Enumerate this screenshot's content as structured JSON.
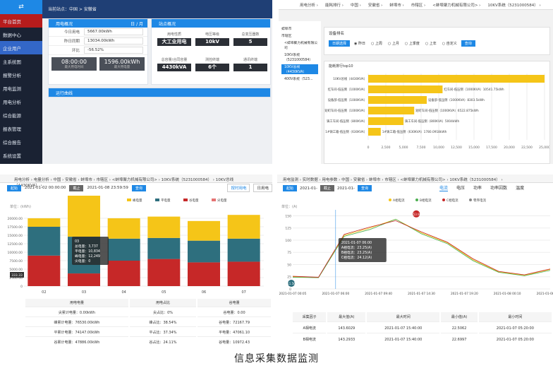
{
  "p1": {
    "top_icon": "⇄",
    "sidebar": [
      "平台首页",
      "数据中心",
      "企业用户",
      "主系统图",
      "报警分析",
      "用电监测",
      "用电分析",
      "综合能源",
      "报表管理",
      "综合报告",
      "系统设置"
    ],
    "breadcrumb": "当前站点：中国 > 安徽省",
    "elec_title": "用电概况",
    "period": "日 / 月",
    "rows": [
      {
        "k": "今日用电",
        "v": "5667.00kWh"
      },
      {
        "k": "昨日同期",
        "v": "13034.00kWh"
      },
      {
        "k": "环比",
        "v": "-56.52%"
      }
    ],
    "max_time": "08:00:00",
    "max_val": "1596.00kWh",
    "max_time_label": "最大用电时间",
    "max_val_label": "最大用电量",
    "site_title": "站点概况",
    "tiles": [
      {
        "l": "用电性质",
        "v": "大工业用电"
      },
      {
        "l": "电压等级",
        "v": "10kV"
      },
      {
        "l": "总变压器数",
        "v": "5"
      },
      {
        "l": "总容量/合同容量",
        "v": "4430kVA"
      },
      {
        "l": "测控终端",
        "v": "6个"
      },
      {
        "l": "通讯终端",
        "v": "1"
      }
    ],
    "curve_title": "运行曲线"
  },
  "p2": {
    "address": [
      "用电分析",
      "能耗排行",
      "中国",
      "安徽省",
      "蚌埠市",
      "市辖区",
      "<蚌埠聚力机械有限公司>",
      "10KV系统（5231000584）"
    ],
    "tree": [
      "蚌埠市",
      "市辖区",
      "<蚌埠聚力机械有限公司",
      "10KV系统（5231000584）",
      "10KV总线（4430KVA）",
      "400V系统（523..."
    ],
    "filter_label": "设备排名",
    "radio": [
      "昨日",
      "上周",
      "上月",
      "上季度",
      "上年",
      "自定义"
    ],
    "btn_day": "日期选择",
    "btn_query": "查询",
    "chart_title": "能耗排行top10"
  },
  "p3": {
    "address": [
      "用电分析",
      "电量分析",
      "中国",
      "安徽省",
      "蚌埠市",
      "市辖区",
      "<蚌埠聚力机械有限公司>",
      "10KV系统（5231000584）",
      "10KV总线（4430KVA）"
    ],
    "start_btn": "起始",
    "start": "2021-01-02 00:00:00",
    "end_btn": "截止",
    "end": "2021-01-08 23:59:59",
    "query": "查询",
    "tab_a": "按时用电",
    "tab_b": "日用电",
    "unit": "单位：(kWh)",
    "tooltip": [
      "03",
      "总电量：3,737",
      "平电量：10,834",
      "峰电量：12,249",
      "尖电量：0"
    ],
    "left_tag": "333.33",
    "table_headers": [
      "用电电量",
      "用电占比",
      "谷电量"
    ],
    "table": [
      [
        "尖累计电量：0.00kWh",
        "尖占比：0%",
        "谷电量：0.00"
      ],
      [
        "峰累计电量：76530.00kWh",
        "峰占比：38.54%",
        "谷电量：72167.79"
      ],
      [
        "平累计电量：74147.00kWh",
        "平占比：37.34%",
        "平电量：47061.10"
      ],
      [
        "谷累计电量：47886.00kWh",
        "谷占比：24.11%",
        "谷电量：10972.43"
      ]
    ]
  },
  "p4": {
    "address": [
      "用电监测",
      "实时数据",
      "用电参数",
      "中国",
      "安徽省",
      "蚌埠市",
      "市辖区",
      "<蚌埠聚力机械有限公司>",
      "10KV系统（5231000584）"
    ],
    "start": "2021-01-",
    "end": "2021-01-",
    "start_btn": "起始",
    "end_btn": "截止",
    "query": "查询",
    "tabs": [
      "电流",
      "电压",
      "功率",
      "功率因数",
      "温度"
    ],
    "unit": "单位：(A)",
    "tooltip": [
      "2021-01-07 06:00",
      "A相电流：23.25(A)",
      "B相电流：23.25(A)",
      "C相电流：24.12(A)"
    ],
    "table_headers": [
      "采集因子",
      "最大值(A)",
      "最大时间",
      "最小值(A)",
      "最小时间"
    ],
    "table": [
      [
        "A相电流",
        "143.6029",
        "2021-01-07 15:40:00",
        "22.5062",
        "2021-01-07 05:20:00"
      ],
      [
        "B相电流",
        "143.2933",
        "2021-01-07 15:40:00",
        "22.6997",
        "2021-01-07 05:20:00"
      ]
    ]
  },
  "caption": "信息采集数据监测",
  "chart_data": [
    {
      "type": "bar",
      "title": "能耗排行top10",
      "categories": [
        "10KV总线（4430KVA）",
        "红车间-低压侧（1000KVA）",
        "设备部-低压侧（1000KVA）",
        "短町车间-低压侧（1000KVA）",
        "铸工车间-低压侧（800KVA）",
        "1#铸工箱-低压侧（630KVA）"
      ],
      "values": [
        25000,
        10541.75,
        8303.5,
        6522.875,
        5004,
        1780.09
      ],
      "value_labels": [
        "",
        "红车间-低压侧（1000KVA）10541.75kWh",
        "设备部-低压侧（1000KVA）8303.5kWh",
        "短町车间-低压侧（1000KVA）6522.875kWh",
        "铸工车间-低压侧（800KVA）5004kWh",
        "1#铸工箱-低压侧（630KVA）1780.0918kWh"
      ],
      "xticks": [
        "0",
        "2,500",
        "5,000",
        "7,500",
        "10,000",
        "12,500",
        "15,000",
        "17,500",
        "20,000",
        "22,500",
        "25,000"
      ],
      "xlim": [
        0,
        25000
      ]
    },
    {
      "type": "bar",
      "categories": [
        "02",
        "03",
        "04",
        "05",
        "06",
        "07"
      ],
      "legend": [
        "峰电量",
        "平电量",
        "谷电量",
        "尖电量"
      ],
      "series": [
        {
          "name": "谷电量",
          "values": [
            9000,
            3737,
            7500,
            8000,
            7000,
            7200
          ]
        },
        {
          "name": "平电量",
          "values": [
            8500,
            10834,
            6500,
            6200,
            6400,
            6800
          ]
        },
        {
          "name": "峰电量",
          "values": [
            2500,
            12249,
            6000,
            6300,
            5800,
            7000
          ]
        },
        {
          "name": "尖电量",
          "values": [
            0,
            0,
            0,
            0,
            0,
            0
          ]
        }
      ],
      "yticks": [
        "0",
        "2500.00",
        "5000.00",
        "7500.00",
        "10000.00",
        "12500.00",
        "15000.00",
        "17500.00",
        "20000.00"
      ],
      "ylim": [
        0,
        20000
      ]
    },
    {
      "type": "line",
      "legend": [
        "A相电流",
        "B相电流",
        "C相电流",
        "零序电流"
      ],
      "x": [
        "2021-01-07 00:05",
        "2021-01-07 06:00",
        "2021-01-07 09:40",
        "2021-01-07 14:30",
        "2021-01-07 19:20",
        "2021-01-08 00:10",
        "2021-01-08 04:50"
      ],
      "xticks": [
        "2021-01-07 00:05",
        "2021-01-07 06:00",
        "2021-01-07 09:40",
        "2021-01-07 14:30",
        "2021-01-07 19:20",
        "2021-01-08 00:10",
        "2021-01-08 04:50"
      ],
      "series": [
        {
          "name": "A相电流",
          "values": [
            25,
            23,
            110,
            125,
            143,
            115,
            95,
            60,
            35,
            28,
            40
          ]
        },
        {
          "name": "B相电流",
          "values": [
            24,
            23,
            108,
            122,
            143,
            113,
            93,
            58,
            34,
            27,
            38
          ]
        },
        {
          "name": "C相电流",
          "values": [
            26,
            24,
            112,
            127,
            140,
            117,
            96,
            62,
            36,
            29,
            41
          ]
        }
      ],
      "yticks": [
        "0",
        "25",
        "50",
        "75",
        "100",
        "125",
        "150"
      ],
      "ylim": [
        0,
        159.4
      ],
      "markers": [
        "11.56",
        "153.91"
      ]
    }
  ]
}
